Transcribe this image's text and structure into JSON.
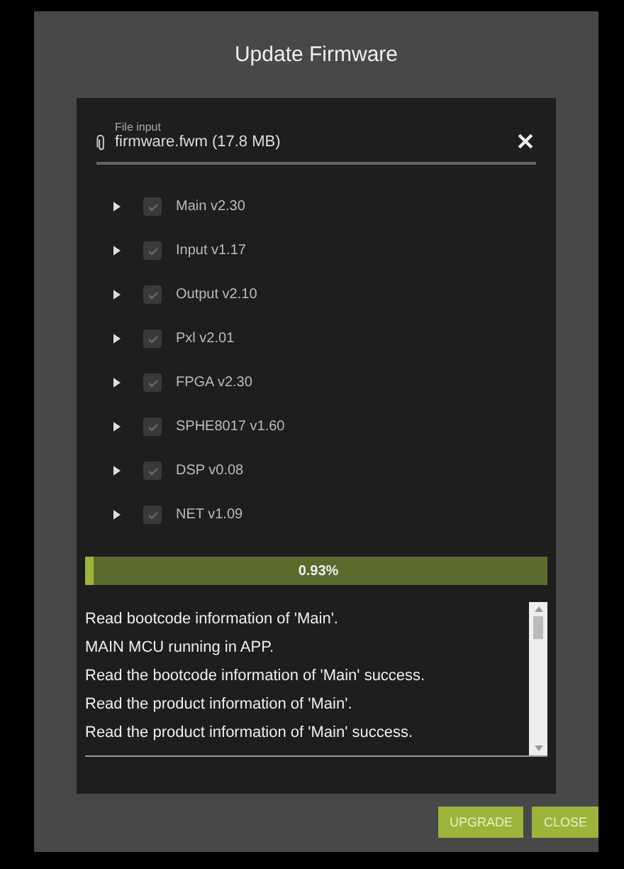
{
  "dialog": {
    "title": "Update Firmware"
  },
  "file_input": {
    "label": "File input",
    "value": "firmware.fwm (17.8 MB)"
  },
  "modules": [
    {
      "label": "Main v2.30",
      "checked": true,
      "expanded": false
    },
    {
      "label": "Input v1.17",
      "checked": true,
      "expanded": false
    },
    {
      "label": "Output v2.10",
      "checked": true,
      "expanded": false
    },
    {
      "label": "Pxl v2.01",
      "checked": true,
      "expanded": false
    },
    {
      "label": "FPGA v2.30",
      "checked": true,
      "expanded": false
    },
    {
      "label": "SPHE8017 v1.60",
      "checked": true,
      "expanded": false
    },
    {
      "label": "DSP v0.08",
      "checked": true,
      "expanded": false
    },
    {
      "label": "NET v1.09",
      "checked": true,
      "expanded": false
    }
  ],
  "progress": {
    "level": 0.0093,
    "label": "0.93%"
  },
  "log": [
    "Read bootcode information of 'Main'.",
    "MAIN MCU running in APP.",
    "Read the bootcode information of 'Main'  success.",
    "Read the product information of 'Main'.",
    "Read the product information of 'Main'  success."
  ],
  "buttons": [
    "UPGRADE",
    "CLOSE"
  ]
}
